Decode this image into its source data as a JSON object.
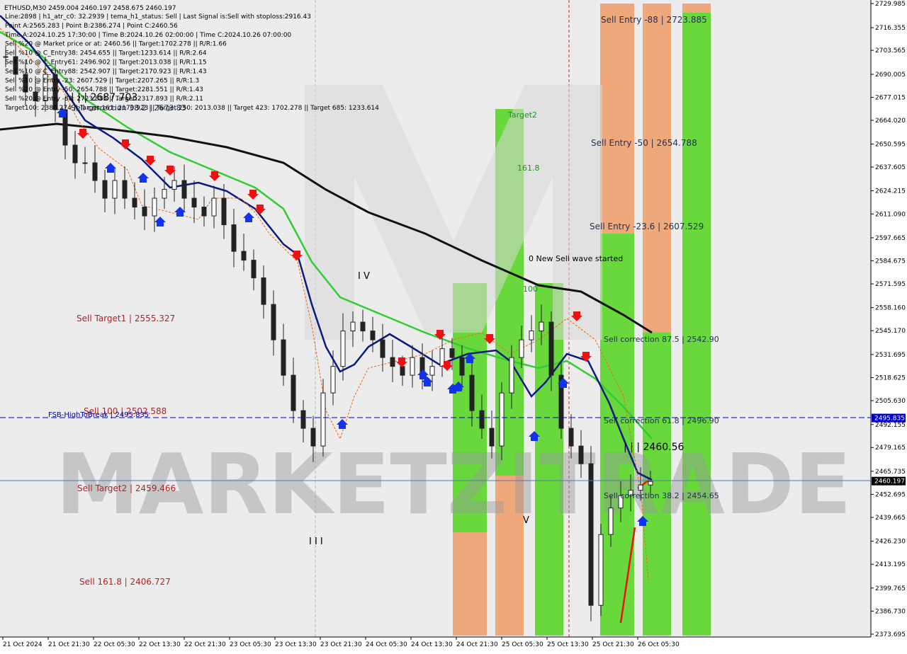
{
  "header": {
    "symbol_line": "ETHUSD,M30  2459.004 2460.197 2458.675 2460.197",
    "info_lines": [
      "Line:2898 | h1_atr_c0: 32.2939 | tema_h1_status: Sell | Last Signal is:Sell with stoploss:2916.43",
      "Point A:2565.283 | Point B:2386.274 | Point C:2460.56",
      "Time A:2024.10.25 17:30:00 | Time B:2024.10.26 02:00:00 | Time C:2024.10.26 07:00:00",
      "Sell %20 @ Market price or at: 2460.56 || Target:1702.278 || R/R:1.66",
      "Sell %10 @ C_Entry38: 2454.655 || Target:1233.614 || R/R:2.64",
      "Sell %10 @ C_Entry61: 2496.902 || Target:2013.038 || R/R:1.15",
      "Sell %10 @ C_Entry88: 2542.907 || Target:2170.923 || R/R:1.43",
      "Sell %10 @ Entry -23: 2607.529 || Target:2207.265 || R/R:1.3",
      "Sell %20 @ Entry -50: 2654.788 || Target:2281.551 || R/R:1.43",
      "Sell %20 @ Entry -88: 2723.885 || Target:2317.893 || R/R:2.11",
      "Target100: 2386.274 || Target 161: 2170.923 || Target 250: 2013.038 || Target 423: 1702.278 || Target 685: 1233.614"
    ]
  },
  "watermark": "MARKETZITRADE",
  "price_axis": {
    "ticks": [
      "2729.985",
      "2716.355",
      "2703.565",
      "2690.005",
      "2677.015",
      "2664.020",
      "2650.595",
      "2637.605",
      "2624.215",
      "2611.090",
      "2597.665",
      "2584.675",
      "2571.595",
      "2558.160",
      "2545.170",
      "2531.695",
      "2518.625",
      "2505.630",
      "2492.155",
      "2479.165",
      "2465.735",
      "2452.695",
      "2439.665",
      "2426.230",
      "2413.195",
      "2399.765",
      "2386.730",
      "2373.695"
    ],
    "tick_values": [
      2729.985,
      2716.355,
      2703.565,
      2690.005,
      2677.015,
      2664.02,
      2650.595,
      2637.605,
      2624.215,
      2611.09,
      2597.665,
      2584.675,
      2571.595,
      2558.16,
      2545.17,
      2531.695,
      2518.625,
      2505.63,
      2492.155,
      2479.165,
      2465.735,
      2452.695,
      2439.665,
      2426.23,
      2413.195,
      2399.765,
      2386.73,
      2373.695
    ],
    "badges": [
      {
        "text": "2495.835",
        "value": 2495.835,
        "color": "#0000cc"
      },
      {
        "text": "2460.197",
        "value": 2460.197,
        "color": "#000000"
      }
    ]
  },
  "time_axis": {
    "labels": [
      "21 Oct 2024",
      "21 Oct 21:30",
      "22 Oct 05:30",
      "22 Oct 13:30",
      "22 Oct 21:30",
      "23 Oct 05:30",
      "23 Oct 13:30",
      "23 Oct 21:30",
      "24 Oct 05:30",
      "24 Oct 13:30",
      "24 Oct 21:30",
      "25 Oct 05:30",
      "25 Oct 13:30",
      "25 Oct 21:30",
      "26 Oct 05:30"
    ]
  },
  "chart_labels": {
    "sell_target1": "Sell Target1 | 2555.327",
    "sell100": "Sell 100 | 2502.588",
    "fsb": "FSB-HighToBreak | 2495.835",
    "sell_target2": "Sell Target2 | 2459.466",
    "sell1618": "Sell 161.8 | 2406.727",
    "sell_entry_88": "Sell Entry -88 | 2723.885",
    "sell_entry_50": "Sell Entry -50 | 2654.788",
    "sell_entry_23": "Sell Entry -23.6 | 2607.529",
    "new_wave": "0 New Sell wave started",
    "corr875": "Sell correction 87.5 | 2542.90",
    "corr618": "Sell correction 61.8 | 2496.90",
    "corr382": "Sell correction 38.2 | 2454.65",
    "point_c": "| | | 2460.56",
    "corr382_left": "Sell correction 38.2 | 2673.83",
    "point_left": "| | | 2687.703",
    "target2": "Target2",
    "t1618": "161.8",
    "t100": "100",
    "wave_iv": "I V",
    "wave_iii": "I I I",
    "wave_v": "V"
  },
  "chart_data": {
    "type": "candlestick",
    "symbol": "ETHUSD",
    "timeframe": "M30",
    "ylim": [
      2373.695,
      2729.985
    ],
    "close_approx": [
      2700,
      2690,
      2680,
      2675,
      2690,
      2670,
      2650,
      2640,
      2640,
      2630,
      2620,
      2630,
      2620,
      2615,
      2610,
      2620,
      2625,
      2630,
      2620,
      2615,
      2610,
      2620,
      2605,
      2590,
      2585,
      2575,
      2560,
      2540,
      2520,
      2500,
      2490,
      2480,
      2510,
      2525,
      2545,
      2550,
      2545,
      2540,
      2530,
      2525,
      2520,
      2530,
      2520,
      2525,
      2535,
      2530,
      2520,
      2500,
      2490,
      2480,
      2510,
      2530,
      2540,
      2545,
      2550,
      2520,
      2490,
      2480,
      2470,
      2390,
      2430,
      2445,
      2452,
      2455,
      2458,
      2460
    ],
    "levels": {
      "fsb_high_to_break": 2495.835,
      "current_price": 2460.197,
      "sell_target1": 2555.327,
      "sell_100": 2502.588,
      "sell_target2": 2459.466,
      "sell_161_8": 2406.727
    },
    "grid": false
  }
}
